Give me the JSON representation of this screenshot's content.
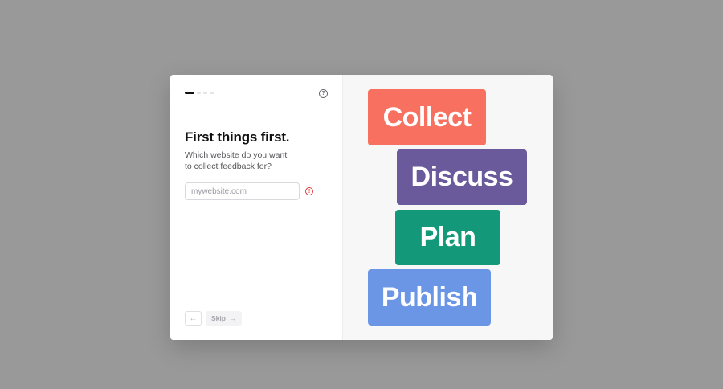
{
  "onboarding": {
    "progress": {
      "total_steps": 4,
      "current_step": 1
    },
    "help_icon": "question-circle-icon",
    "title": "First things first.",
    "subtitle": "Which website do you want to collect feedback for?",
    "website_input": {
      "value": "",
      "placeholder": "mywebsite.com"
    },
    "error_icon": "exclamation-circle-icon",
    "back_icon": "arrow-left-icon",
    "skip_label": "Skip",
    "skip_icon": "arrow-right-icon"
  },
  "illustration": {
    "blocks": [
      {
        "label": "Collect",
        "color": "#f87060"
      },
      {
        "label": "Discuss",
        "color": "#6a5a9c"
      },
      {
        "label": "Plan",
        "color": "#14987a"
      },
      {
        "label": "Publish",
        "color": "#6b96e6"
      }
    ]
  }
}
